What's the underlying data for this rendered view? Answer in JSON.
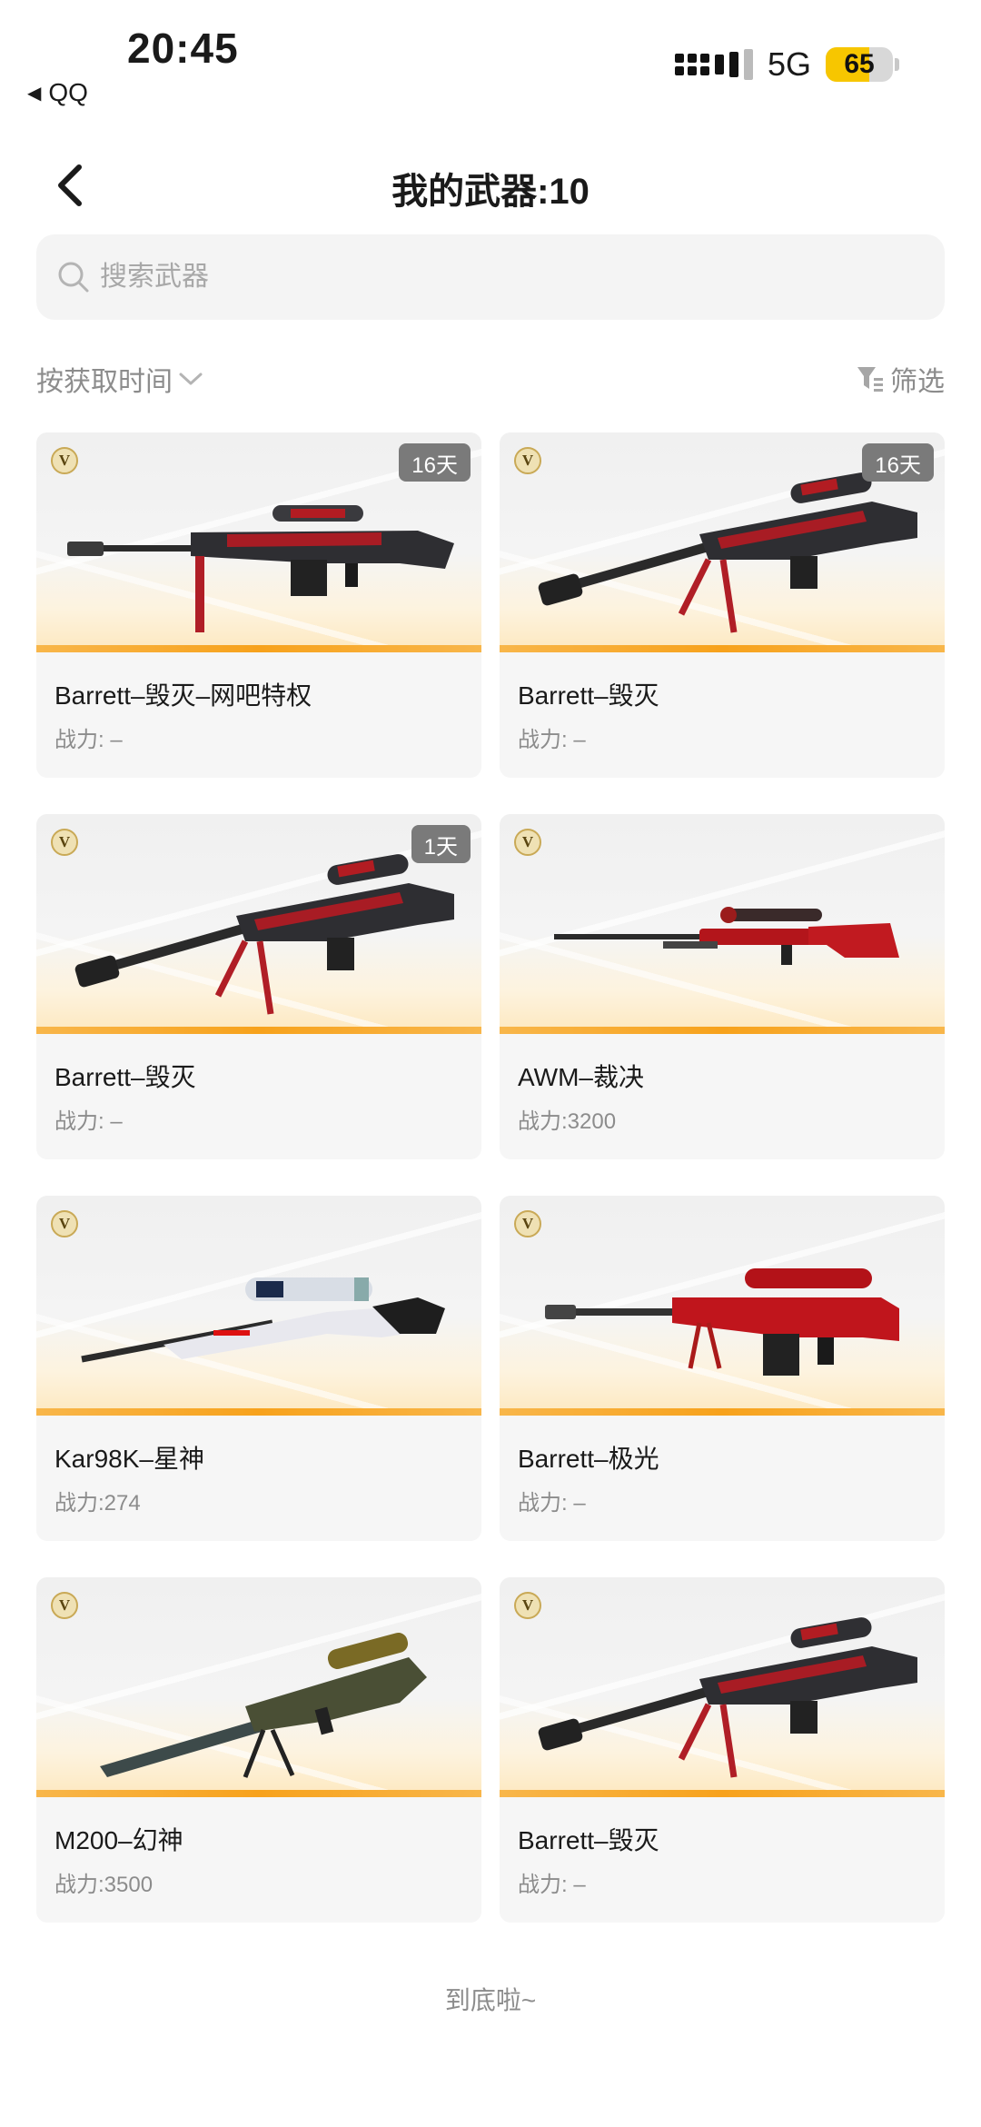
{
  "status": {
    "time": "20:45",
    "back_app": "QQ",
    "network": "5G",
    "battery": "65"
  },
  "header": {
    "title": "我的武器:10"
  },
  "search": {
    "placeholder": "搜索武器"
  },
  "sort": {
    "label": "按获取时间",
    "filter_label": "筛选"
  },
  "weapons": [
    {
      "name": "Barrett–毁灭–网吧特权",
      "power": "战力: –",
      "tag": "16天",
      "style": "barrett"
    },
    {
      "name": "Barrett–毁灭",
      "power": "战力: –",
      "tag": "16天",
      "style": "barrett2"
    },
    {
      "name": "Barrett–毁灭",
      "power": "战力: –",
      "tag": "1天",
      "style": "barrett2"
    },
    {
      "name": "AWM–裁决",
      "power": "战力:3200",
      "tag": "",
      "style": "awm"
    },
    {
      "name": "Kar98K–星神",
      "power": "战力:274",
      "tag": "",
      "style": "kar"
    },
    {
      "name": "Barrett–极光",
      "power": "战力: –",
      "tag": "",
      "style": "red"
    },
    {
      "name": "M200–幻神",
      "power": "战力:3500",
      "tag": "",
      "style": "m200"
    },
    {
      "name": "Barrett–毁灭",
      "power": "战力: –",
      "tag": "",
      "style": "barrett2"
    }
  ],
  "badge_letter": "V",
  "footer": {
    "end_text": "到底啦~"
  },
  "colors": {
    "accent": "#f7a21c",
    "battery": "#f7c600",
    "tag_bg": "#7a7a7a"
  }
}
